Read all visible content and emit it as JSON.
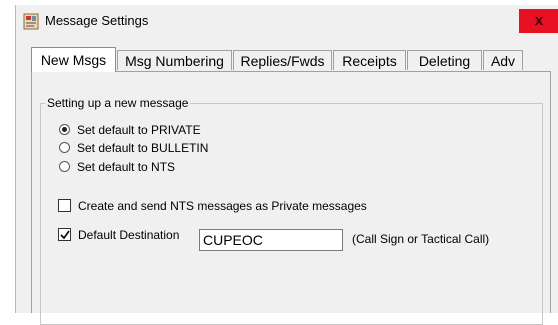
{
  "window": {
    "title": "Message Settings",
    "close_glyph": "x",
    "app_icon": "envelope-settings-icon"
  },
  "tabs": [
    {
      "label": "New Msgs",
      "active": true
    },
    {
      "label": "Msg Numbering",
      "active": false
    },
    {
      "label": "Replies/Fwds",
      "active": false
    },
    {
      "label": "Receipts",
      "active": false
    },
    {
      "label": "Deleting",
      "active": false
    },
    {
      "label": "Adv",
      "active": false
    }
  ],
  "group": {
    "label": "Setting up a new message",
    "radios": [
      {
        "label": "Set default to PRIVATE",
        "checked": true
      },
      {
        "label": "Set default to BULLETIN",
        "checked": false
      },
      {
        "label": "Set default to NTS",
        "checked": false
      }
    ],
    "nts_private": {
      "label": "Create and send NTS messages as Private messages",
      "checked": false
    },
    "default_destination": {
      "label": "Default Destination",
      "checked": true,
      "value": "CUPEOC",
      "hint": "(Call Sign or Tactical Call)"
    }
  },
  "colors": {
    "close_button": "#e81123",
    "dialog_background": "#f0f0f0"
  }
}
